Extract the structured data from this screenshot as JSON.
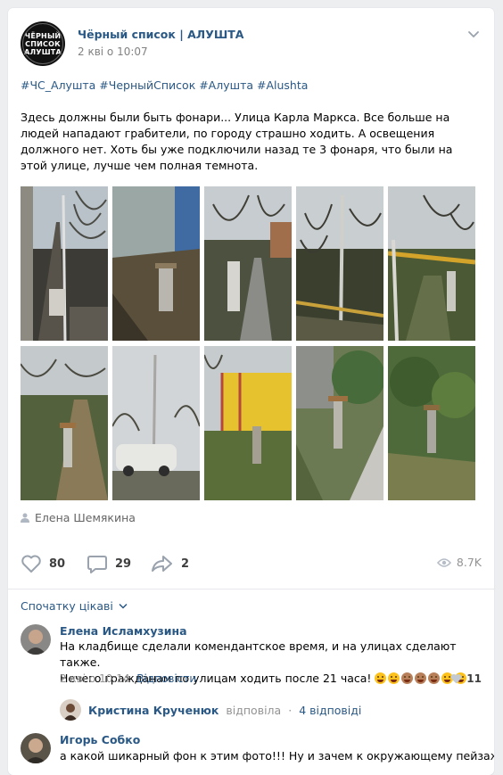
{
  "post": {
    "group_name": "Чёрный список | АЛУШТА",
    "avatar_lines": [
      "ЧЁРНЫЙ",
      "СПИСОК",
      "АЛУШТА"
    ],
    "date": "2 кві о 10:07",
    "hashtags": "#ЧС_Алушта #ЧерныйСписок #Алушта #Alushta",
    "text": "Здесь должны были быть фонари... Улица Карла Маркса. Все больше на людей нападают грабители, по городу страшно ходить. А освещения должного нет. Хоть бы уже подключили назад те 3 фонаря, что были на этой улице, лучше чем полная темнота.",
    "photos_count": 10,
    "author": "Елена Шемякина"
  },
  "actions": {
    "likes": "80",
    "comments": "29",
    "shares": "2",
    "views": "8.7K"
  },
  "comments_section": {
    "sort_label": "Спочатку цікаві"
  },
  "comments": [
    {
      "name": "Елена Исламхузина",
      "line1": "На кладбище сделали комендантское время, и на улицах сделают также.",
      "line2": "Нечего гражданам по улицам ходить после 21 часа!",
      "date": "2 кві о 10:14",
      "reply_label": "Відповісти",
      "likes": "11"
    },
    {
      "name": "Игорь Собко",
      "line1": "а какой шикарный фон к этим фото!!! Ну и зачем к окружающему пейзажу"
    }
  ],
  "reply_thread": {
    "name": "Кристина Крученюк",
    "verb": "відповіла",
    "separator": "·",
    "count": "4 відповіді"
  },
  "colors": {
    "link": "#2a5885",
    "muted": "#939393",
    "background": "#edeef0",
    "card": "#ffffff"
  },
  "icons": {
    "more": "chevron-down-icon",
    "author": "person-icon",
    "like": "heart-icon",
    "comment": "comment-bubble-icon",
    "share": "share-arrow-icon",
    "views": "eye-icon",
    "sort": "chevron-down-icon",
    "comment_like": "heart-icon"
  }
}
